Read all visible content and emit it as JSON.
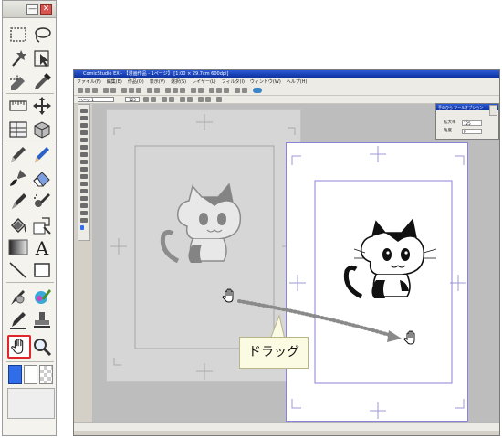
{
  "palette": {
    "tools": [
      {
        "name": "rectangle-select-icon"
      },
      {
        "name": "lasso-icon"
      },
      {
        "name": "magic-wand-icon"
      },
      {
        "name": "object-select-icon"
      },
      {
        "name": "select-pen-icon"
      },
      {
        "name": "eyedropper-icon"
      },
      {
        "name": "ruler-icon"
      },
      {
        "name": "move-icon"
      },
      {
        "name": "frame-icon"
      },
      {
        "name": "box-3d-icon"
      },
      {
        "name": "pen-icon"
      },
      {
        "name": "pencil-icon"
      },
      {
        "name": "brush-icon"
      },
      {
        "name": "eraser-icon"
      },
      {
        "name": "marker-icon"
      },
      {
        "name": "airbrush-icon"
      },
      {
        "name": "fill-icon"
      },
      {
        "name": "shape-fill-icon"
      },
      {
        "name": "gradient-icon"
      },
      {
        "name": "text-icon",
        "glyph": "A"
      },
      {
        "name": "line-icon"
      },
      {
        "name": "rectangle-icon"
      },
      {
        "name": "pattern-brush-icon"
      },
      {
        "name": "tone-icon"
      },
      {
        "name": "correction-pen-icon"
      },
      {
        "name": "stamp-icon"
      },
      {
        "name": "hand-icon",
        "highlighted": true
      },
      {
        "name": "zoom-icon"
      }
    ],
    "colors": {
      "main": "#2f6ee8",
      "sub": "#ffffff",
      "transparent": "checker"
    }
  },
  "app": {
    "title": "ComicStudio EX - 【漫画作品 - 1ページ】 [1:00 × 29.7cm 600dpi]",
    "menu": [
      "ファイル(F)",
      "編集(E)",
      "作品(Q)",
      "表示(V)",
      "選択(S)",
      "レイヤー(L)",
      "フィルタ(I)",
      "ウィンドウ(W)",
      "ヘルプ(H)"
    ],
    "page_select": "ページ 1",
    "zoom": "125",
    "tool_options": {
      "title": "手のひら ツールオプション",
      "zoom_label": "拡大率",
      "zoom_value": "125",
      "angle_label": "角度",
      "angle_value": "0"
    }
  },
  "callout": {
    "text": "ドラッグ"
  },
  "accent": {
    "highlight": "#e0262b",
    "arrow": "#8a8a8a"
  }
}
